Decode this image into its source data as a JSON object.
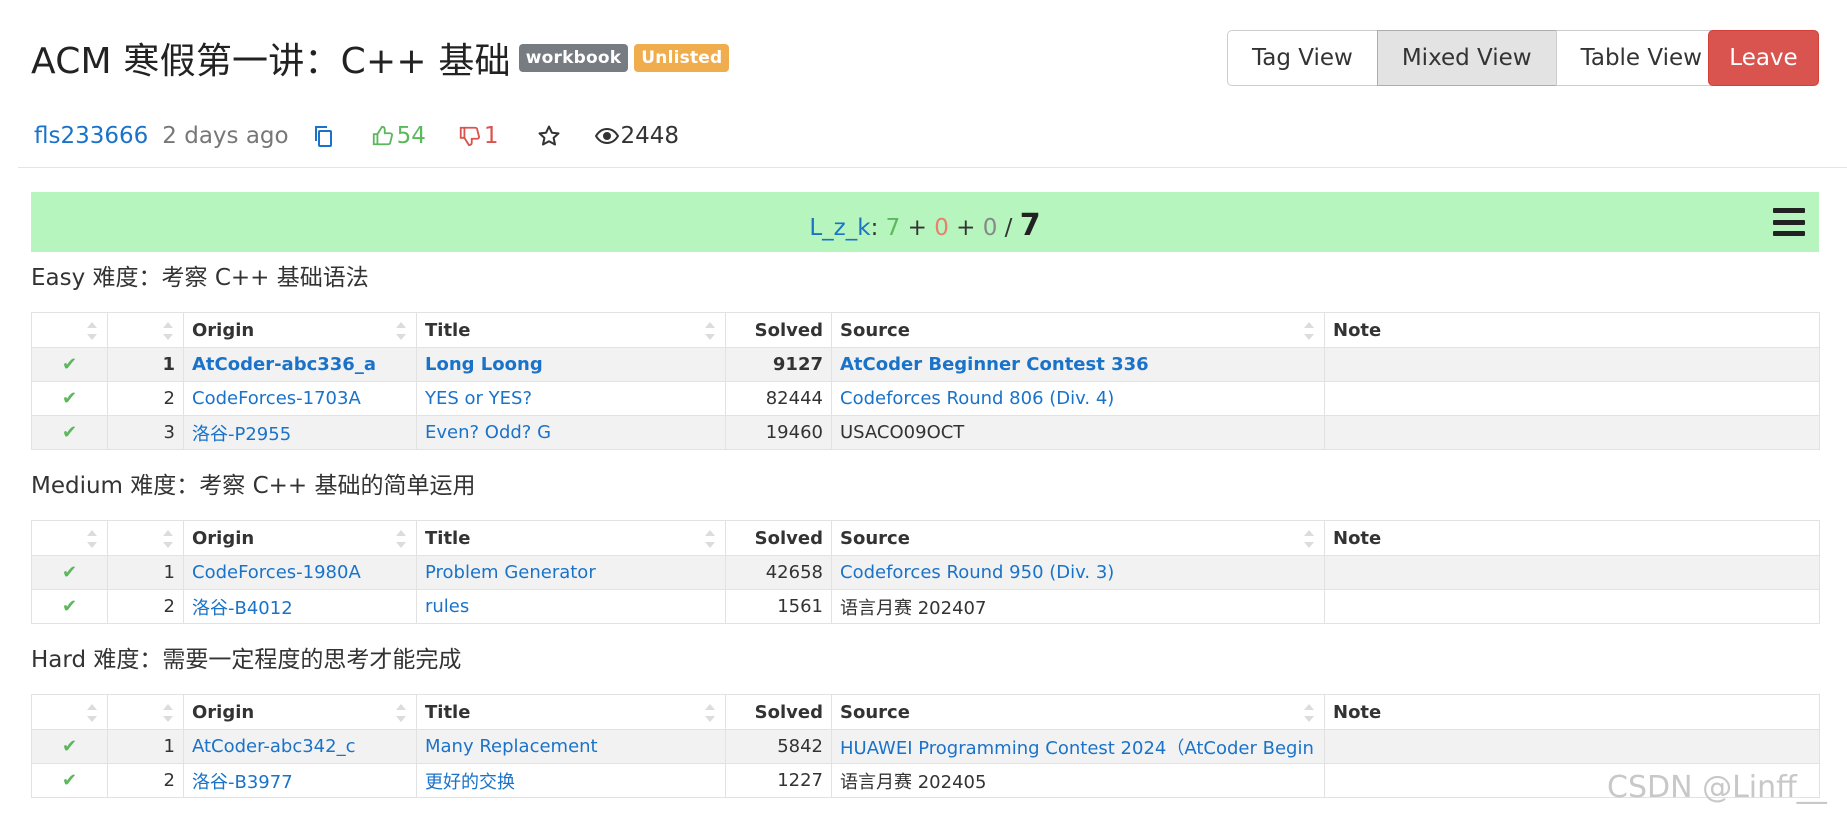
{
  "header": {
    "title": "ACM 寒假第一讲：C++ 基础",
    "badges": {
      "workbook": "workbook",
      "unlisted": "Unlisted"
    },
    "views": {
      "tag": "Tag View",
      "mixed": "Mixed View",
      "table": "Table View"
    },
    "active_view": "Mixed View",
    "leave_label": "Leave"
  },
  "meta": {
    "author": "fls233666",
    "time": "2 days ago",
    "upvotes": "54",
    "downvotes": "1",
    "views": "2448",
    "icons": [
      "copy-icon",
      "thumbs-up-icon",
      "thumbs-down-icon",
      "star-icon",
      "eye-icon"
    ]
  },
  "progress": {
    "user": "L_z_k",
    "solved": "7",
    "wrong": "0",
    "untried": "0",
    "total": "7",
    "bg_color": "#b6f5bd"
  },
  "columns": {
    "origin": "Origin",
    "title": "Title",
    "solved": "Solved",
    "source": "Source",
    "note": "Note"
  },
  "sections": [
    {
      "heading": "Easy 难度：考察 C++ 基础语法",
      "rows": [
        {
          "num": "1",
          "origin": "AtCoder-abc336_a",
          "title": "Long Loong",
          "solved": "9127",
          "source": "AtCoder Beginner Contest 336",
          "note": ""
        },
        {
          "num": "2",
          "origin": "CodeForces-1703A",
          "title": "YES or YES?",
          "solved": "82444",
          "source": "Codeforces Round 806 (Div. 4)",
          "note": ""
        },
        {
          "num": "3",
          "origin": "洛谷-P2955",
          "title": "Even? Odd? G",
          "solved": "19460",
          "source": "USACO09OCT",
          "note": ""
        }
      ]
    },
    {
      "heading": "Medium 难度：考察 C++ 基础的简单运用",
      "rows": [
        {
          "num": "1",
          "origin": "CodeForces-1980A",
          "title": "Problem Generator",
          "solved": "42658",
          "source": "Codeforces Round 950 (Div. 3)",
          "note": ""
        },
        {
          "num": "2",
          "origin": "洛谷-B4012",
          "title": "rules",
          "solved": "1561",
          "source": "语言月赛 202407",
          "note": ""
        }
      ]
    },
    {
      "heading": "Hard 难度：需要一定程度的思考才能完成",
      "rows": [
        {
          "num": "1",
          "origin": "AtCoder-abc342_c",
          "title": "Many Replacement",
          "solved": "5842",
          "source": "HUAWEI Programming Contest 2024（AtCoder Begin",
          "note": ""
        },
        {
          "num": "2",
          "origin": "洛谷-B3977",
          "title": "更好的交换",
          "solved": "1227",
          "source": "语言月赛 202405",
          "note": ""
        }
      ]
    }
  ],
  "watermark": "CSDN @Linff__"
}
